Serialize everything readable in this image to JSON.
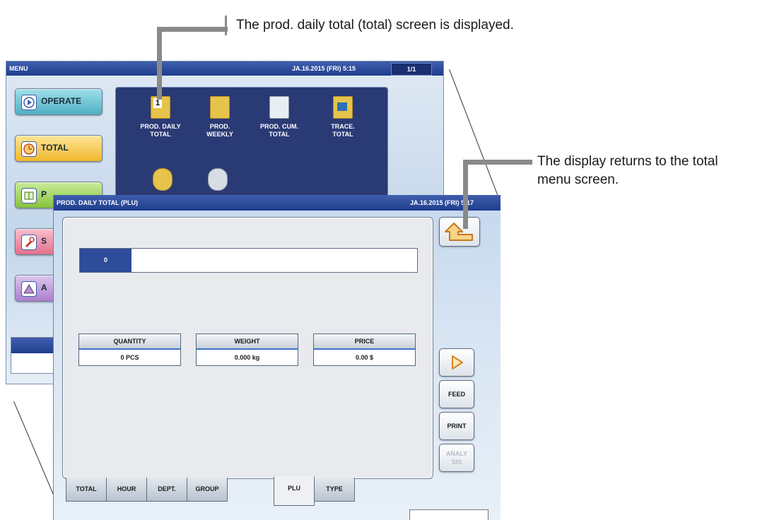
{
  "annotations": {
    "step_number": "1",
    "step_text": "The prod. daily total (total) screen is displayed.",
    "return_text_line1": "The display returns to the total",
    "return_text_line2": "menu screen."
  },
  "menu_window": {
    "title": "MENU",
    "datetime": "JA.16.2015 (FRI)  5:15",
    "page": "1/1",
    "sidebar": [
      {
        "label": "OPERATE",
        "color": "#58b9c8"
      },
      {
        "label": "TOTAL",
        "color": "#f3c342"
      },
      {
        "label": "P",
        "color": "#9ccf4f"
      },
      {
        "label": "S",
        "color": "#e9819a"
      },
      {
        "label": "A",
        "color": "#b58cd0"
      }
    ],
    "tiles": [
      {
        "line1": "PROD. DAILY",
        "line2": "TOTAL",
        "icon": "daily-total-icon"
      },
      {
        "line1": "PROD.",
        "line2": "WEEKLY",
        "icon": "weekly-icon"
      },
      {
        "line1": "PROD. CUM.",
        "line2": "TOTAL",
        "icon": "cumulative-total-icon"
      },
      {
        "line1": "TRACE.",
        "line2": "TOTAL",
        "icon": "trace-total-icon"
      }
    ]
  },
  "front_window": {
    "title": "PROD. DAILY TOTAL (PLU)",
    "datetime": "JA.16.2015 (FRI)  5:17",
    "plu_number": "0",
    "stats": [
      {
        "header": "QUANTITY",
        "value": "0 PCS"
      },
      {
        "header": "WEIGHT",
        "value": "0.000 kg"
      },
      {
        "header": "PRICE",
        "value": "0.00 $"
      }
    ],
    "buttons": {
      "feed": "FEED",
      "print": "PRINT",
      "analysis_line1": "ANALY",
      "analysis_line2": "SIS"
    },
    "tabs": [
      "TOTAL",
      "HOUR",
      "DEPT.",
      "GROUP",
      "PLU",
      "TYPE"
    ],
    "active_tab": "PLU"
  }
}
